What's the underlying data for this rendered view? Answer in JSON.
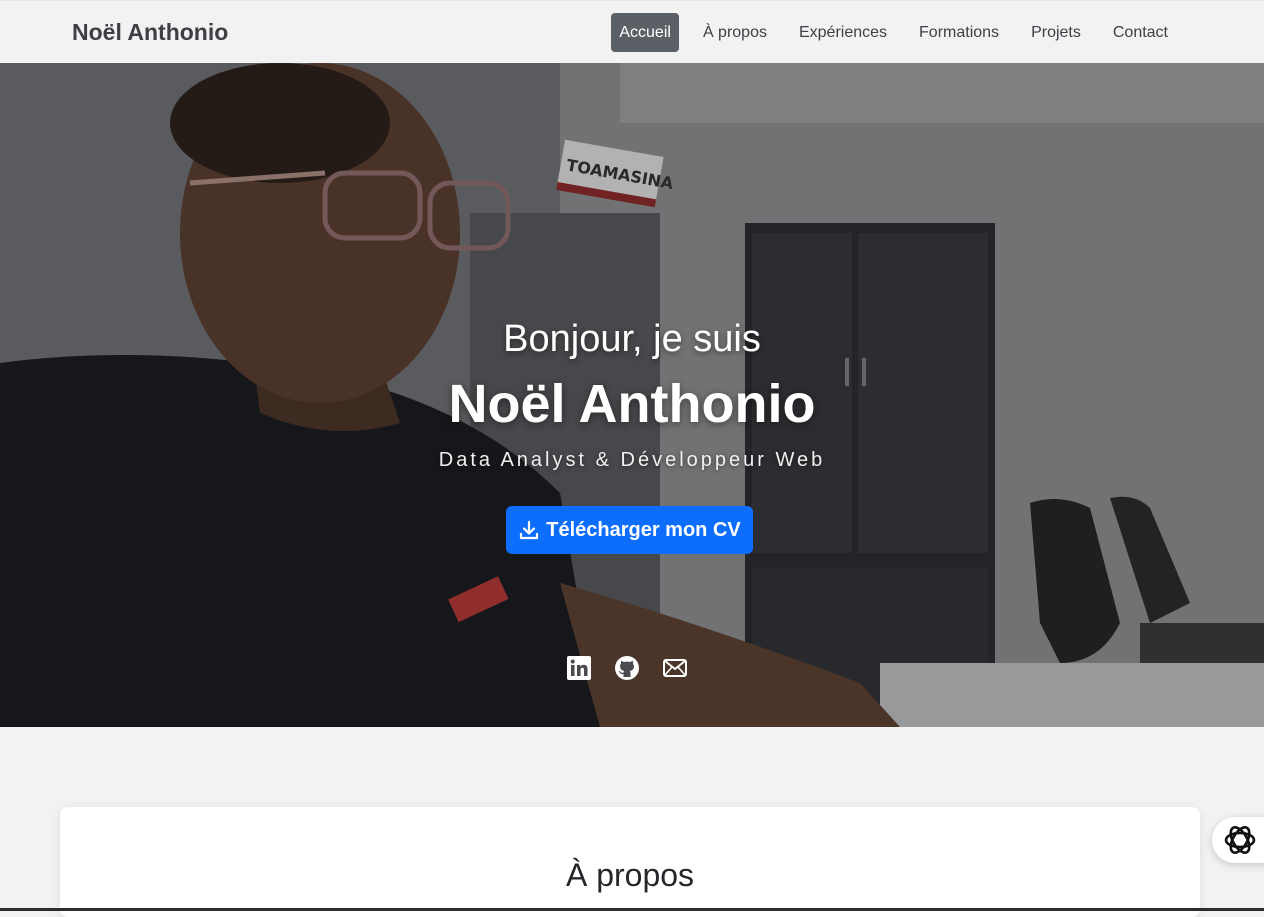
{
  "navbar": {
    "brand": "Noël Anthonio",
    "items": [
      {
        "label": "Accueil",
        "active": true
      },
      {
        "label": "À propos"
      },
      {
        "label": "Expériences"
      },
      {
        "label": "Formations"
      },
      {
        "label": "Projets"
      },
      {
        "label": "Contact"
      }
    ]
  },
  "hero": {
    "greeting": "Bonjour, je suis",
    "name": "Noël Anthonio",
    "role": "Data Analyst & Développeur Web",
    "cv_button": "Télécharger mon CV",
    "socials": [
      "linkedin-icon",
      "github-icon",
      "email-icon"
    ]
  },
  "about": {
    "title": "À propos"
  },
  "colors": {
    "primary": "#0d6efd",
    "nav_active": "#5a6066"
  }
}
